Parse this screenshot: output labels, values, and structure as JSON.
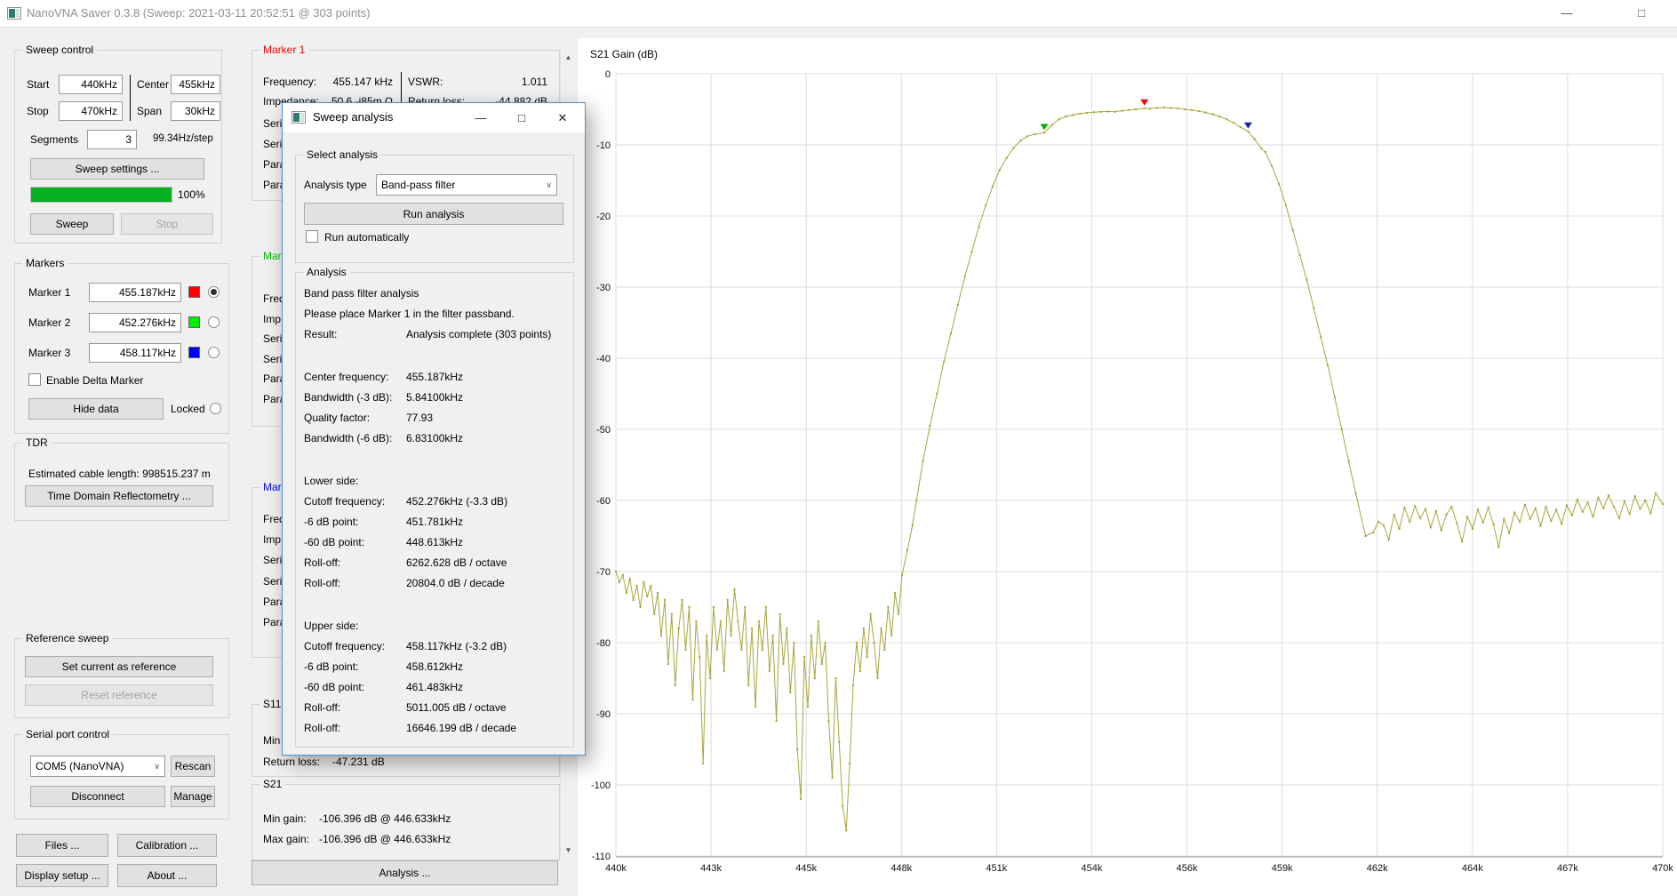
{
  "window": {
    "title": "NanoVNA Saver 0.3.8 (Sweep: 2021-03-11 20:52:51 @ 303 points)",
    "minimize": "—",
    "maximize": "□",
    "close": "✕"
  },
  "sweep_control": {
    "group_label": "Sweep control",
    "start_label": "Start",
    "start_value": "440kHz",
    "center_label": "Center",
    "center_value": "455kHz",
    "stop_label": "Stop",
    "stop_value": "470kHz",
    "span_label": "Span",
    "span_value": "30kHz",
    "segments_label": "Segments",
    "segments_value": "3",
    "step_text": "99.34Hz/step",
    "settings_button": "Sweep settings ...",
    "progress_percent": "100%",
    "sweep_button": "Sweep",
    "stop_button": "Stop"
  },
  "markers_panel": {
    "group_label": "Markers",
    "rows": [
      {
        "label": "Marker 1",
        "value": "455.187kHz",
        "color": "#ff0000",
        "selected": true
      },
      {
        "label": "Marker 2",
        "value": "452.276kHz",
        "color": "#00ee00",
        "selected": false
      },
      {
        "label": "Marker 3",
        "value": "458.117kHz",
        "color": "#0000ff",
        "selected": false
      }
    ],
    "delta_checkbox_label": "Enable Delta Marker",
    "hide_data_button": "Hide data",
    "locked_label": "Locked"
  },
  "tdr": {
    "group_label": "TDR",
    "cable_length_text": "Estimated cable length:  998515.237 m",
    "button": "Time Domain Reflectometry ..."
  },
  "reference_sweep": {
    "group_label": "Reference sweep",
    "set_button": "Set current as reference",
    "reset_button": "Reset reference"
  },
  "serial_port": {
    "group_label": "Serial port control",
    "port_value": "COM5 (NanoVNA)",
    "chevron": "∨",
    "rescan_button": "Rescan",
    "disconnect_button": "Disconnect",
    "manage_button": "Manage"
  },
  "bottom_buttons": {
    "files": "Files ...",
    "calibration": "Calibration ...",
    "display_setup": "Display setup ...",
    "about": "About ..."
  },
  "marker_column": {
    "marker1": {
      "title": "Marker 1",
      "title_color": "#ff0000",
      "row1": {
        "label": "Frequency:",
        "value": "455.147 kHz",
        "label2": "VSWR:",
        "value2": "1.011"
      },
      "row2": {
        "label": "Impedance:",
        "value": "50.6 -j85m Ω",
        "label2": "Return loss:",
        "value2": "-44.882 dB"
      },
      "hidden_fragments": [
        "Seri",
        "Seri",
        "Para",
        "Para"
      ]
    },
    "marker2": {
      "title_fragment": "Mark",
      "title_color": "#00c000",
      "hidden_fragments": [
        "Freq",
        "Imp",
        "Seri",
        "Seri",
        "Para",
        "Para"
      ]
    },
    "marker3": {
      "title_fragment": "Mark",
      "title_color": "#0000ff",
      "hidden_fragments": [
        "Freq",
        "Imp",
        "Seri",
        "Seri",
        "Para",
        "Para"
      ]
    },
    "s11": {
      "title": "S11",
      "row1_fragment": "Min",
      "return_loss_label": "Return loss:",
      "return_loss_value": "-47.231 dB"
    },
    "s21": {
      "title": "S21",
      "min_gain_label": "Min gain:",
      "min_gain_value": "-106.396 dB @ 446.633kHz",
      "max_gain_label": "Max gain:",
      "max_gain_value": "-106.396 dB @ 446.633kHz"
    },
    "analysis_button": "Analysis ...",
    "scroll_up": "▲",
    "scroll_down": "▼"
  },
  "dialog": {
    "title": "Sweep analysis",
    "minimize": "—",
    "maximize": "□",
    "close": "✕",
    "select_group_label": "Select analysis",
    "analysis_type_label": "Analysis type",
    "analysis_type_value": "Band-pass filter",
    "chevron": "∨",
    "run_button": "Run analysis",
    "run_auto_label": "Run automatically",
    "analysis_group_label": "Analysis",
    "result_rows": [
      {
        "label": "Band pass filter analysis",
        "value": ""
      },
      {
        "label": "Please place Marker 1 in the filter passband.",
        "value": ""
      },
      {
        "label": "Result:",
        "value": "Analysis complete (303 points)"
      },
      {
        "type": "gap"
      },
      {
        "label": "Center frequency:",
        "value": "455.187kHz"
      },
      {
        "label": "Bandwidth (-3 dB):",
        "value": "5.84100kHz"
      },
      {
        "label": "Quality factor:",
        "value": "77.93"
      },
      {
        "label": "Bandwidth (-6 dB):",
        "value": "6.83100kHz"
      },
      {
        "type": "gap"
      },
      {
        "label": "Lower side:",
        "value": ""
      },
      {
        "label": "Cutoff frequency:",
        "value": "452.276kHz (-3.3 dB)"
      },
      {
        "label": "-6 dB point:",
        "value": "451.781kHz"
      },
      {
        "label": "-60 dB point:",
        "value": "448.613kHz"
      },
      {
        "label": "Roll-off:",
        "value": "6262.628 dB / octave"
      },
      {
        "label": "Roll-off:",
        "value": "20804.0 dB / decade"
      },
      {
        "type": "gap"
      },
      {
        "label": "Upper side:",
        "value": ""
      },
      {
        "label": "Cutoff frequency:",
        "value": "458.117kHz (-3.2 dB)"
      },
      {
        "label": "-6 dB point:",
        "value": "458.612kHz"
      },
      {
        "label": "-60 dB point:",
        "value": "461.483kHz"
      },
      {
        "label": "Roll-off:",
        "value": "5011.005 dB / octave"
      },
      {
        "label": "Roll-off:",
        "value": "16646.199 dB / decade"
      }
    ]
  },
  "chart_data": {
    "type": "line",
    "title": "S21 Gain (dB)",
    "trace_color": "#a8a53c",
    "grid_color": "#dcdcdc",
    "x_range_khz": [
      440,
      470
    ],
    "y_range_db": [
      0,
      -110
    ],
    "x_tick_labels": [
      "440k",
      "443k",
      "445k",
      "448k",
      "451k",
      "454k",
      "456k",
      "459k",
      "462k",
      "464k",
      "467k",
      "470k"
    ],
    "y_tick_labels": [
      "0",
      "-10",
      "-20",
      "-30",
      "-40",
      "-50",
      "-60",
      "-70",
      "-80",
      "-90",
      "-100",
      "-110"
    ],
    "markers": [
      {
        "name": "marker-1",
        "freq": 455.147,
        "db": -4.85,
        "color": "#ff0000"
      },
      {
        "name": "marker-2",
        "freq": 452.276,
        "db": -8.3,
        "color": "#00b000"
      },
      {
        "name": "marker-3",
        "freq": 458.117,
        "db": -8.1,
        "color": "#2222b0"
      }
    ],
    "series": [
      [
        440.0,
        -70
      ],
      [
        440.1,
        -71.5
      ],
      [
        440.2,
        -70.5
      ],
      [
        440.3,
        -73
      ],
      [
        440.4,
        -71
      ],
      [
        440.5,
        -74
      ],
      [
        440.6,
        -72
      ],
      [
        440.7,
        -75
      ],
      [
        440.8,
        -71.5
      ],
      [
        440.9,
        -73.5
      ],
      [
        441.0,
        -72
      ],
      [
        441.1,
        -76
      ],
      [
        441.2,
        -73
      ],
      [
        441.3,
        -79
      ],
      [
        441.4,
        -74
      ],
      [
        441.5,
        -83
      ],
      [
        441.6,
        -76
      ],
      [
        441.7,
        -86
      ],
      [
        441.8,
        -78
      ],
      [
        441.9,
        -74
      ],
      [
        442.0,
        -81
      ],
      [
        442.1,
        -75
      ],
      [
        442.2,
        -88
      ],
      [
        442.3,
        -77
      ],
      [
        442.4,
        -82
      ],
      [
        442.5,
        -97
      ],
      [
        442.6,
        -79
      ],
      [
        442.7,
        -85
      ],
      [
        442.8,
        -75
      ],
      [
        442.9,
        -81
      ],
      [
        443.0,
        -77
      ],
      [
        443.1,
        -84
      ],
      [
        443.2,
        -74
      ],
      [
        443.3,
        -79
      ],
      [
        443.4,
        -72.5
      ],
      [
        443.5,
        -77
      ],
      [
        443.6,
        -81
      ],
      [
        443.7,
        -75
      ],
      [
        443.8,
        -86
      ],
      [
        443.9,
        -78
      ],
      [
        444.0,
        -89
      ],
      [
        444.1,
        -77
      ],
      [
        444.2,
        -81
      ],
      [
        444.3,
        -75
      ],
      [
        444.4,
        -84
      ],
      [
        444.5,
        -79
      ],
      [
        444.6,
        -91
      ],
      [
        444.7,
        -76
      ],
      [
        444.8,
        -83
      ],
      [
        444.9,
        -78
      ],
      [
        445.0,
        -87
      ],
      [
        445.1,
        -80
      ],
      [
        445.2,
        -95
      ],
      [
        445.3,
        -102
      ],
      [
        445.4,
        -82
      ],
      [
        445.5,
        -89
      ],
      [
        445.6,
        -79
      ],
      [
        445.7,
        -85
      ],
      [
        445.8,
        -77
      ],
      [
        445.9,
        -83
      ],
      [
        446.0,
        -80
      ],
      [
        446.1,
        -91
      ],
      [
        446.2,
        -99
      ],
      [
        446.3,
        -85
      ],
      [
        446.4,
        -94
      ],
      [
        446.5,
        -103
      ],
      [
        446.6,
        -106.4
      ],
      [
        446.7,
        -97
      ],
      [
        446.8,
        -86
      ],
      [
        446.9,
        -80
      ],
      [
        447.0,
        -84
      ],
      [
        447.1,
        -78
      ],
      [
        447.2,
        -82
      ],
      [
        447.3,
        -76
      ],
      [
        447.4,
        -80
      ],
      [
        447.5,
        -85
      ],
      [
        447.6,
        -78
      ],
      [
        447.7,
        -81
      ],
      [
        447.8,
        -75
      ],
      [
        447.9,
        -79
      ],
      [
        448.0,
        -73
      ],
      [
        448.1,
        -76
      ],
      [
        448.2,
        -70.5
      ],
      [
        448.35,
        -67
      ],
      [
        448.5,
        -63.5
      ],
      [
        448.613,
        -60
      ],
      [
        448.8,
        -54.5
      ],
      [
        449.0,
        -49.5
      ],
      [
        449.2,
        -45
      ],
      [
        449.4,
        -40.5
      ],
      [
        449.6,
        -36.5
      ],
      [
        449.8,
        -32.5
      ],
      [
        450.0,
        -28.5
      ],
      [
        450.2,
        -25
      ],
      [
        450.4,
        -21.5
      ],
      [
        450.6,
        -18.5
      ],
      [
        450.8,
        -15.8
      ],
      [
        451.0,
        -13.5
      ],
      [
        451.2,
        -11.8
      ],
      [
        451.4,
        -10.4
      ],
      [
        451.6,
        -9.4
      ],
      [
        451.781,
        -8.8
      ],
      [
        452.0,
        -8.5
      ],
      [
        452.276,
        -8.3
      ],
      [
        452.5,
        -7.2
      ],
      [
        452.7,
        -6.4
      ],
      [
        452.9,
        -6.0
      ],
      [
        453.1,
        -5.8
      ],
      [
        453.3,
        -5.6
      ],
      [
        453.5,
        -5.5
      ],
      [
        453.7,
        -5.4
      ],
      [
        453.9,
        -5.35
      ],
      [
        454.1,
        -5.3
      ],
      [
        454.3,
        -5.35
      ],
      [
        454.5,
        -5.2
      ],
      [
        454.7,
        -5.1
      ],
      [
        454.9,
        -5.0
      ],
      [
        455.147,
        -4.85
      ],
      [
        455.3,
        -4.9
      ],
      [
        455.5,
        -4.8
      ],
      [
        455.7,
        -4.75
      ],
      [
        455.9,
        -4.8
      ],
      [
        456.1,
        -4.85
      ],
      [
        456.3,
        -5.0
      ],
      [
        456.5,
        -5.1
      ],
      [
        456.7,
        -5.25
      ],
      [
        456.9,
        -5.45
      ],
      [
        457.1,
        -5.7
      ],
      [
        457.3,
        -6.0
      ],
      [
        457.5,
        -6.4
      ],
      [
        457.7,
        -6.9
      ],
      [
        457.9,
        -7.5
      ],
      [
        458.117,
        -8.1
      ],
      [
        458.3,
        -9.2
      ],
      [
        458.5,
        -10.5
      ],
      [
        458.612,
        -11
      ],
      [
        458.8,
        -13
      ],
      [
        459.0,
        -15.5
      ],
      [
        459.2,
        -18.5
      ],
      [
        459.4,
        -22
      ],
      [
        459.6,
        -25.5
      ],
      [
        459.8,
        -29
      ],
      [
        460.0,
        -33
      ],
      [
        460.2,
        -37
      ],
      [
        460.4,
        -41
      ],
      [
        460.6,
        -45.5
      ],
      [
        460.8,
        -50
      ],
      [
        461.0,
        -54.5
      ],
      [
        461.2,
        -59
      ],
      [
        461.483,
        -65
      ],
      [
        461.7,
        -64.5
      ],
      [
        461.85,
        -63
      ],
      [
        462.0,
        -63.5
      ],
      [
        462.15,
        -65.5
      ],
      [
        462.3,
        -62
      ],
      [
        462.45,
        -64
      ],
      [
        462.6,
        -61
      ],
      [
        462.75,
        -63
      ],
      [
        462.9,
        -60.8
      ],
      [
        463.05,
        -62.5
      ],
      [
        463.2,
        -61.2
      ],
      [
        463.35,
        -63.8
      ],
      [
        463.5,
        -61.5
      ],
      [
        463.65,
        -64.2
      ],
      [
        463.8,
        -62
      ],
      [
        463.95,
        -60.9
      ],
      [
        464.1,
        -63.2
      ],
      [
        464.25,
        -65.8
      ],
      [
        464.4,
        -62.3
      ],
      [
        464.55,
        -64
      ],
      [
        464.7,
        -61.3
      ],
      [
        464.85,
        -63.1
      ],
      [
        465.0,
        -61
      ],
      [
        465.15,
        -63.4
      ],
      [
        465.3,
        -66.6
      ],
      [
        465.45,
        -62.6
      ],
      [
        465.6,
        -64.6
      ],
      [
        465.75,
        -61.7
      ],
      [
        465.9,
        -63
      ],
      [
        466.05,
        -60.6
      ],
      [
        466.2,
        -62.6
      ],
      [
        466.35,
        -61.1
      ],
      [
        466.5,
        -63.6
      ],
      [
        466.65,
        -60.9
      ],
      [
        466.8,
        -62.9
      ],
      [
        466.95,
        -61.3
      ],
      [
        467.1,
        -63.3
      ],
      [
        467.25,
        -60.7
      ],
      [
        467.4,
        -62.1
      ],
      [
        467.55,
        -59.9
      ],
      [
        467.7,
        -61.6
      ],
      [
        467.85,
        -60.3
      ],
      [
        468.0,
        -62.3
      ],
      [
        468.15,
        -59.6
      ],
      [
        468.3,
        -61.1
      ],
      [
        468.45,
        -59.3
      ],
      [
        468.6,
        -60.9
      ],
      [
        468.75,
        -62.5
      ],
      [
        468.9,
        -60.1
      ],
      [
        469.05,
        -61.9
      ],
      [
        469.2,
        -59.4
      ],
      [
        469.35,
        -61.2
      ],
      [
        469.5,
        -60.0
      ],
      [
        469.65,
        -61.8
      ],
      [
        469.8,
        -59.0
      ],
      [
        470.0,
        -60.5
      ]
    ]
  }
}
